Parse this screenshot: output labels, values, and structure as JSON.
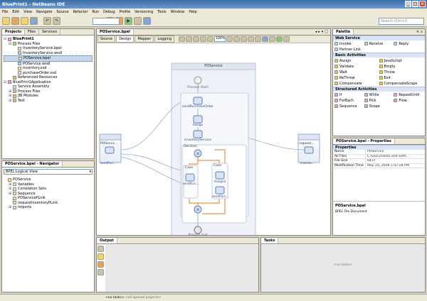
{
  "window": {
    "title": "BluePrint1 - NetBeans IDE"
  },
  "menu": [
    "File",
    "Edit",
    "View",
    "Navigate",
    "Source",
    "Refactor",
    "Run",
    "Debug",
    "Profile",
    "Versioning",
    "Tools",
    "Window",
    "Help"
  ],
  "toolbar": {
    "search_placeholder": "Search (Ctrl+I)"
  },
  "projects": {
    "tabs": [
      "Projects",
      "Files",
      "Services"
    ],
    "items": [
      {
        "label": "BluePrint1",
        "level": 0,
        "icon": "project-icon",
        "expanded": true,
        "bold": true
      },
      {
        "label": "Process Files",
        "level": 1,
        "icon": "folder-icon",
        "expanded": true
      },
      {
        "label": "InventoryService.bpel",
        "level": 2,
        "icon": "bpel-file-icon"
      },
      {
        "label": "InventoryService.wsdl",
        "level": 2,
        "icon": "wsdl-file-icon"
      },
      {
        "label": "POService.bpel",
        "level": 2,
        "icon": "bpel-file-icon",
        "selected": true
      },
      {
        "label": "POService.wsdl",
        "level": 2,
        "icon": "wsdl-file-icon"
      },
      {
        "label": "inventory.xsd",
        "level": 2,
        "icon": "xsd-file-icon"
      },
      {
        "label": "purchaseOrder.xsd",
        "level": 2,
        "icon": "xsd-file-icon"
      },
      {
        "label": "Referenced Resources",
        "level": 1,
        "icon": "folder-icon"
      },
      {
        "label": "BluePrint1Application",
        "level": 0,
        "icon": "project-icon",
        "expanded": true
      },
      {
        "label": "Service Assembly",
        "level": 1,
        "icon": "assembly-icon"
      },
      {
        "label": "Process Files",
        "level": 1,
        "icon": "folder-icon",
        "expandable": true
      },
      {
        "label": "JBI Modules",
        "level": 1,
        "icon": "folder-icon",
        "expandable": true
      },
      {
        "label": "Test",
        "level": 1,
        "icon": "folder-icon",
        "expandable": true
      }
    ]
  },
  "navigator": {
    "title": "POService.bpel - Navigator",
    "view": "BPEL Logical View",
    "items": [
      {
        "label": "POService",
        "level": 0
      },
      {
        "label": "Variables",
        "level": 1,
        "expandable": true
      },
      {
        "label": "Correlation Sets",
        "level": 1,
        "expandable": true
      },
      {
        "label": "Sequence",
        "level": 1,
        "expandable": true
      },
      {
        "label": "POServicePLink",
        "level": 1
      },
      {
        "label": "requestInventoryPLink",
        "level": 1
      },
      {
        "label": "Imports",
        "level": 1,
        "expandable": true
      }
    ]
  },
  "editor": {
    "tab": "POService.bpel",
    "views": [
      "Source",
      "Design",
      "Mapper",
      "Logging"
    ],
    "active_view": "Design",
    "zoom": "100%",
    "process": {
      "name": "POService",
      "start": "Process Start",
      "end": "Process End",
      "receive": "sendPurchaseOrder",
      "assign1": "Assign",
      "invoke": "inventoryService",
      "decision": "Decision",
      "case1": "Case",
      "case2": "Case",
      "reply1": "sendPurc...",
      "assign2": "Assign2",
      "reply2": "sendPurc...",
      "left_partner": "POServic...",
      "left_op": "sendPurc...",
      "right_partner": "request...",
      "right_op": "invento..."
    }
  },
  "palette": {
    "title": "Palette",
    "sections": [
      {
        "name": "Web Service",
        "cols": 3,
        "items": [
          "Invoke",
          "Receive",
          "Reply",
          "Partner Link"
        ]
      },
      {
        "name": "Basic Activities",
        "cols": 2,
        "items": [
          "Assign",
          "JavaScript",
          "Validate",
          "Empty",
          "Wait",
          "Throw",
          "ReThrow",
          "Exit",
          "Compensate",
          "CompensateScope"
        ]
      },
      {
        "name": "Structured Activities",
        "cols": 3,
        "items": [
          "If",
          "While",
          "RepeatUntil",
          "ForEach",
          "Pick",
          "Flow",
          "Sequence",
          "Scope"
        ]
      }
    ]
  },
  "properties": {
    "title": "POService.bpel - Properties",
    "section": "Properties",
    "rows": [
      {
        "k": "Name",
        "v": "POService"
      },
      {
        "k": "All Files",
        "v": "C:\\Documents and Setti..."
      },
      {
        "k": "File Size",
        "v": "6437"
      },
      {
        "k": "Modification Time",
        "v": "May 20, 2009 1:47:28 PM"
      }
    ],
    "desc_title": "POService.bpel",
    "desc_text": "BPEL File Document"
  },
  "output": {
    "title": "Output"
  },
  "tasks": {
    "title": "Tasks",
    "empty": "<no tasks>",
    "filter": "<no tasks>",
    "scope": "<all opened projects>"
  }
}
